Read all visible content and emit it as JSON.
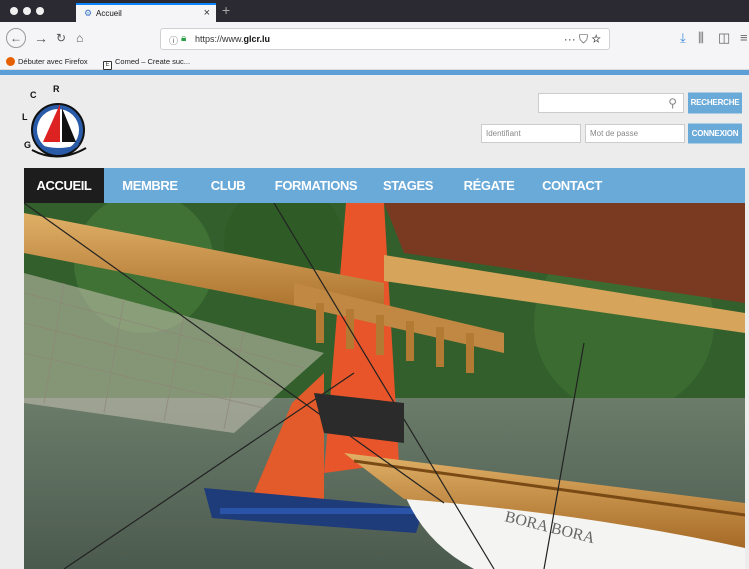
{
  "browser": {
    "tab_title": "Accueil",
    "url_prefix": "https://www.",
    "url_domain": "glcr.lu",
    "bookmarks": [
      "Débuter avec Firefox",
      "Comed – Create suc..."
    ],
    "bookmark2_badge": "E"
  },
  "site": {
    "logo_text": "G L C R",
    "search": {
      "placeholder": "",
      "button": "RECHERCHE"
    },
    "login": {
      "username_placeholder": "Identifiant",
      "password_placeholder": "Mot de passe",
      "button": "CONNEXION"
    },
    "nav": [
      "ACCUEIL",
      "MEMBRE",
      "CLUB",
      "FORMATIONS",
      "STAGES",
      "RÉGATE",
      "CONTACT"
    ],
    "hero_boat_name": "BORA BORA"
  },
  "colors": {
    "accent": "#6aaad9",
    "nav_active": "#1d1d1d",
    "sail_orange": "#e8552a"
  }
}
